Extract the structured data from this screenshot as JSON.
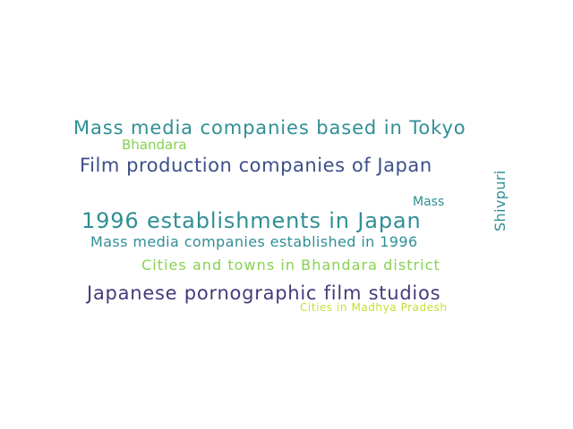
{
  "colors": {
    "background": "#ffffff",
    "teal": "#2f8f95",
    "green": "#86d14f",
    "indigo": "#3b4f8a",
    "purple": "#463a7c",
    "yellow_green": "#c7de33"
  },
  "words": [
    {
      "text": "Mass media companies based in Tokyo",
      "color": "#2f8f95"
    },
    {
      "text": "Bhandara",
      "color": "#86d14f"
    },
    {
      "text": "Film production companies of Japan",
      "color": "#3b4f8a"
    },
    {
      "text": "1996 establishments in Japan",
      "color": "#2f8f95"
    },
    {
      "text": "Mass",
      "color": "#2f8f95"
    },
    {
      "text": "Mass media companies established in 1996",
      "color": "#2f8f95"
    },
    {
      "text": "Cities and towns in Bhandara district",
      "color": "#86d14f"
    },
    {
      "text": "Japanese pornographic film studios",
      "color": "#463a7c"
    },
    {
      "text": "Cities in Madhya Pradesh",
      "color": "#c7de33"
    },
    {
      "text": "Shivpuri",
      "color": "#2f8f95"
    }
  ]
}
